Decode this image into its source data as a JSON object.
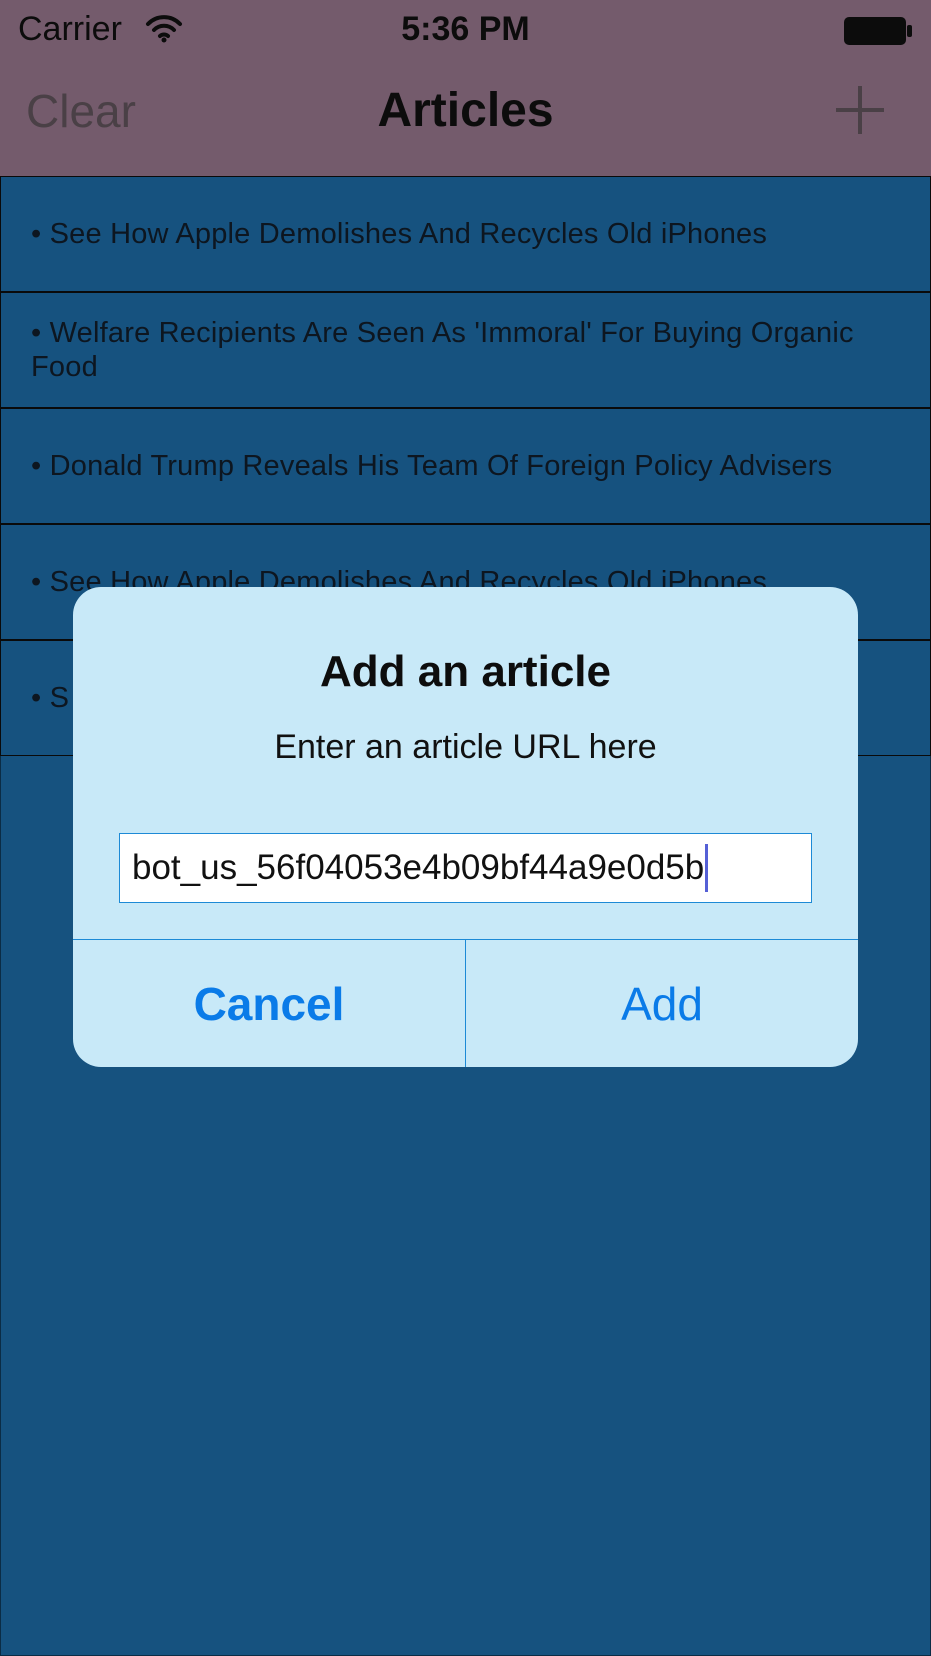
{
  "status_bar": {
    "carrier": "Carrier",
    "time": "5:36 PM",
    "icons": [
      "wifi-icon",
      "battery-icon"
    ]
  },
  "nav": {
    "left_label": "Clear",
    "title": "Articles",
    "right_icon": "plus-icon"
  },
  "articles": [
    {
      "label": "• See How Apple Demolishes And Recycles Old iPhones"
    },
    {
      "label": "• Welfare Recipients Are Seen As 'Immoral' For Buying Organic Food"
    },
    {
      "label": "• Donald Trump Reveals His Team Of Foreign Policy Advisers"
    },
    {
      "label": "• See How Apple Demolishes And Recycles Old iPhones"
    },
    {
      "label": "• S"
    }
  ],
  "dialog": {
    "title": "Add an article",
    "message": "Enter an article URL here",
    "input_value": "bot_us_56f04053e4b09bf44a9e0d5b",
    "cancel_label": "Cancel",
    "add_label": "Add"
  },
  "colors": {
    "nav_background": "#745b6c",
    "list_background": "#16527f",
    "dialog_background": "#c8e9f8",
    "accent": "#0a7be8"
  }
}
